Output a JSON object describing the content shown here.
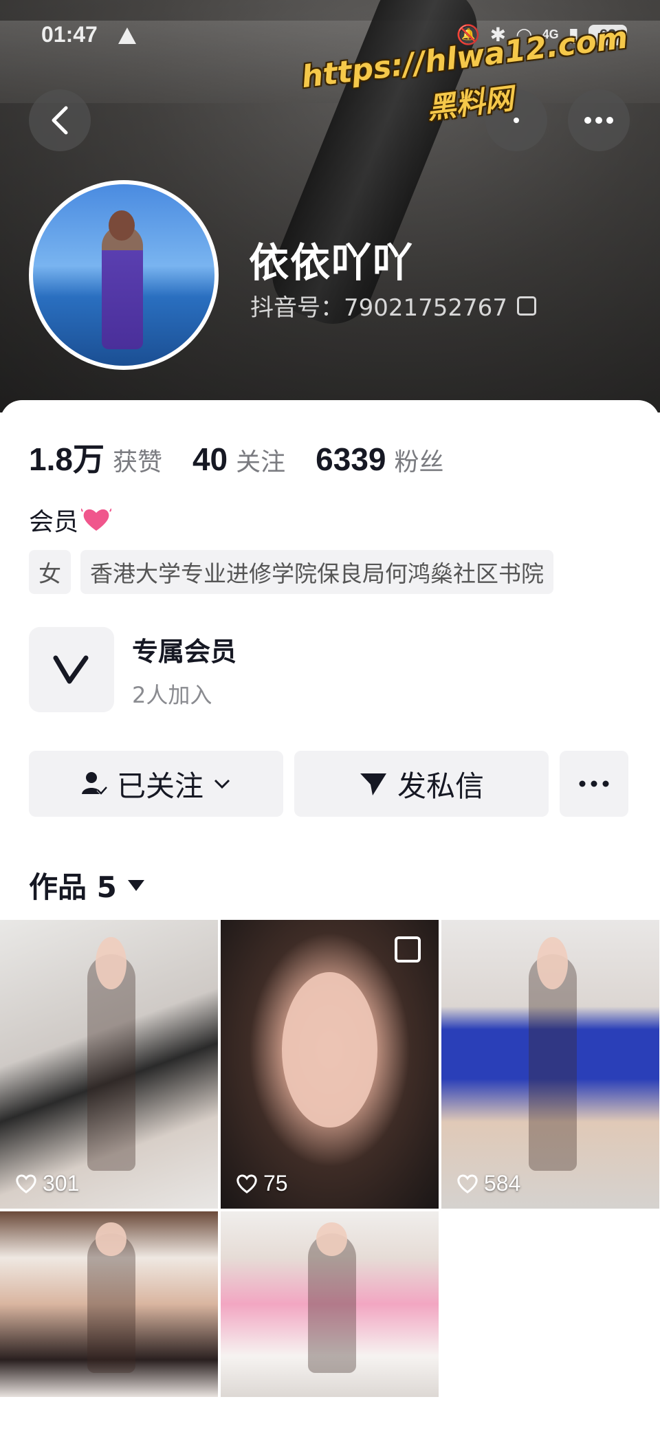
{
  "status_bar": {
    "time": "01:47",
    "network": "4G",
    "battery": "62"
  },
  "watermark": {
    "line1": "https://hlwa12.com",
    "line2": "黑料网"
  },
  "profile": {
    "name": "依依吖吖",
    "douyin_id": "抖音号：79021752767"
  },
  "stats": [
    {
      "value": "1.8万",
      "label": "获赞"
    },
    {
      "value": "40",
      "label": "关注"
    },
    {
      "value": "6339",
      "label": "粉丝"
    }
  ],
  "bio": {
    "text": "会员"
  },
  "tags": [
    "女",
    "香港大学专业进修学院保良局何鸿燊社区书院"
  ],
  "membership": {
    "title": "专属会员",
    "subtitle": "2人加入"
  },
  "actions": {
    "follow": "已关注",
    "message": "发私信"
  },
  "works": {
    "title": "作品 5",
    "items": [
      {
        "likes": "301"
      },
      {
        "likes": "75"
      },
      {
        "likes": "584"
      },
      {
        "likes": ""
      },
      {
        "likes": ""
      }
    ]
  },
  "colors": {
    "text": "#161823",
    "muted": "#7a7b80",
    "button_bg": "#f2f2f4",
    "watermark": "#f5c84a"
  }
}
